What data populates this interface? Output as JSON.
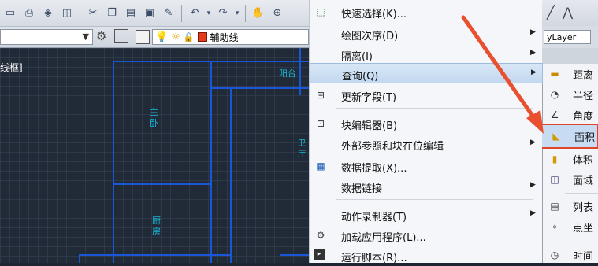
{
  "toolbar": {
    "buttons": [
      "new-icon",
      "save-icon",
      "print-icon",
      "layers-icon",
      "cut-icon",
      "copy-icon",
      "paste-icon",
      "match-icon",
      "brush-icon",
      "undo-icon",
      "redo-icon",
      "pan-icon",
      "zoom-icon"
    ]
  },
  "layer_bar": {
    "layer_name": "辅助线"
  },
  "drawing": {
    "viewport_label": "线框]",
    "rooms": [
      {
        "name": "zhuwo",
        "text": "主\n卧"
      },
      {
        "name": "chufang",
        "text": "厨\n房"
      },
      {
        "name": "yangtai",
        "text": "阳台"
      },
      {
        "name": "ting",
        "text": "卫\n厅"
      }
    ]
  },
  "context_menu": {
    "items": [
      {
        "label": "快速选择(K)...",
        "icon": "quick-select-icon",
        "submenu": false
      },
      {
        "label": "绘图次序(D)",
        "icon": "",
        "submenu": true
      },
      {
        "label": "隔离(I)",
        "icon": "",
        "submenu": true
      },
      {
        "label": "查询(Q)",
        "icon": "",
        "submenu": true
      },
      {
        "label": "更新字段(T)",
        "icon": "update-field-icon",
        "submenu": false
      },
      {
        "label": "块编辑器(B)",
        "icon": "block-editor-icon",
        "submenu": false
      },
      {
        "label": "外部参照和块在位编辑",
        "icon": "",
        "submenu": true
      },
      {
        "label": "数据提取(X)...",
        "icon": "data-extract-icon",
        "submenu": false
      },
      {
        "label": "数据链接",
        "icon": "",
        "submenu": true
      },
      {
        "label": "动作录制器(T)",
        "icon": "",
        "submenu": true
      },
      {
        "label": "加载应用程序(L)...",
        "icon": "load-app-icon",
        "submenu": false
      },
      {
        "label": "运行脚本(R)...",
        "icon": "run-script-icon",
        "submenu": false
      }
    ]
  },
  "right_panel": {
    "linetype": "yLayer"
  },
  "submenu": {
    "items": [
      {
        "label": "距离",
        "icon": "distance-icon"
      },
      {
        "label": "半径",
        "icon": "radius-icon"
      },
      {
        "label": "角度",
        "icon": "angle-icon"
      },
      {
        "label": "面积",
        "icon": "area-icon"
      },
      {
        "label": "体积",
        "icon": "volume-icon"
      },
      {
        "label": "面域",
        "icon": "region-icon"
      },
      {
        "label": "列表",
        "icon": "list-icon"
      },
      {
        "label": "点坐",
        "icon": "point-icon"
      },
      {
        "label": "时间",
        "icon": "time-icon"
      }
    ]
  },
  "colors": {
    "highlight_border": "#e0452a",
    "arrow": "#e8502f",
    "drawing_line": "#1a56d8",
    "room_label": "#18b8d8"
  }
}
